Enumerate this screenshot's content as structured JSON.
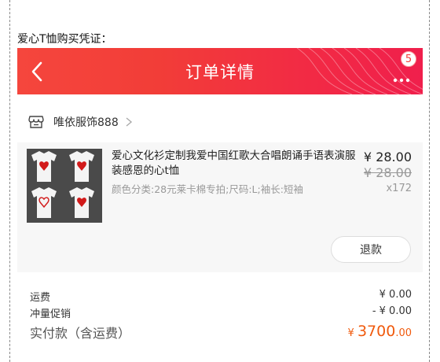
{
  "doc_label": "爱心T恤购买凭证：",
  "header": {
    "title": "订单详情",
    "badge_count": "5",
    "background_color": "#f23d38"
  },
  "shop": {
    "name": "唯依服饰888",
    "icon": "store-icon"
  },
  "item": {
    "title": "爱心文化衫定制我爱中国红歌大合唱朗诵手语表演服装感恩的心t恤",
    "sku": "颜色分类:28元莱卡棉专拍;尺码:L;袖长:短袖",
    "price": "¥ 28.00",
    "original_price": "¥ 28.00",
    "quantity": "x172",
    "refund_label": "退款"
  },
  "summary": {
    "shipping_label": "运费",
    "shipping_value": "¥ 0.00",
    "discount_label": "冲量促销",
    "discount_value": "- ¥ 0.00",
    "total_label": "实付款（含运费）",
    "total_currency": "¥ ",
    "total_integer": "3700",
    "total_decimal": ".00",
    "total_color": "#f05a0d"
  }
}
